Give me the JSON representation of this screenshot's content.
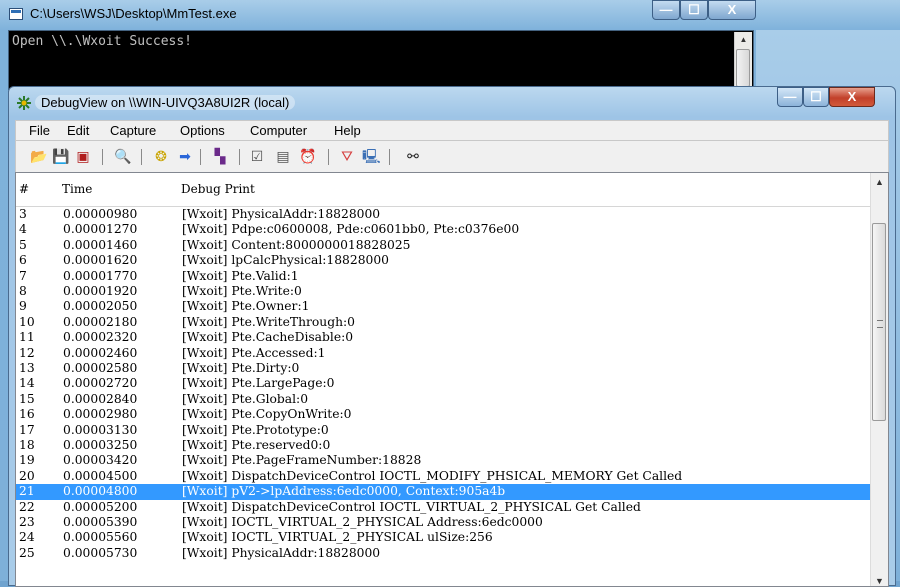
{
  "console": {
    "title": "C:\\Users\\WSJ\\Desktop\\MmTest.exe",
    "output": "Open \\\\.\\Wxoit Success!"
  },
  "window_controls": {
    "minimize": "—",
    "maximize": "☐",
    "close": "X"
  },
  "debugview": {
    "title": "DebugView on \\\\WIN-UIVQ3A8UI2R (local)",
    "menu": [
      "File",
      "Edit",
      "Capture",
      "Options",
      "Computer",
      "Help"
    ],
    "toolbar": [
      {
        "icon": "open-folder-icon",
        "glyph": "📂",
        "color": "#c8961e"
      },
      {
        "icon": "save-icon",
        "glyph": "💾",
        "color": "#1d2b8a"
      },
      {
        "icon": "clear-icon",
        "glyph": "▣",
        "color": "#b01c1c"
      },
      {
        "icon": "find-icon",
        "glyph": "🔍",
        "color": "#2a2a2a"
      },
      {
        "icon": "capture-icon",
        "glyph": "❂",
        "color": "#c9a400"
      },
      {
        "icon": "autoscroll-icon",
        "glyph": "➡",
        "color": "#2a66d9"
      },
      {
        "icon": "filter-icon",
        "glyph": "▚",
        "color": "#6b2a8a"
      },
      {
        "icon": "options-icon",
        "glyph": "☑",
        "color": "#555555"
      },
      {
        "icon": "history-icon",
        "glyph": "▤",
        "color": "#555555"
      },
      {
        "icon": "clock-icon",
        "glyph": "⏰",
        "color": "#c9a400"
      },
      {
        "icon": "highlight-icon",
        "glyph": "⛛",
        "color": "#d64040"
      },
      {
        "icon": "computer-icon",
        "glyph": "🖳",
        "color": "#3a6fb5"
      },
      {
        "icon": "binoculars-icon",
        "glyph": "⚯",
        "color": "#222222"
      }
    ],
    "columns": {
      "num": "#",
      "time": "Time",
      "message": "Debug Print"
    },
    "selected_row": "21",
    "rows": [
      {
        "num": "3",
        "time": "0.00000980",
        "msg": "[Wxoit] PhysicalAddr:18828000"
      },
      {
        "num": "4",
        "time": "0.00001270",
        "msg": "[Wxoit] Pdpe:c0600008, Pde:c0601bb0, Pte:c0376e00"
      },
      {
        "num": "5",
        "time": "0.00001460",
        "msg": "[Wxoit] Content:8000000018828025"
      },
      {
        "num": "6",
        "time": "0.00001620",
        "msg": "[Wxoit] lpCalcPhysical:18828000"
      },
      {
        "num": "7",
        "time": "0.00001770",
        "msg": "[Wxoit] Pte.Valid:1"
      },
      {
        "num": "8",
        "time": "0.00001920",
        "msg": "[Wxoit] Pte.Write:0"
      },
      {
        "num": "9",
        "time": "0.00002050",
        "msg": "[Wxoit] Pte.Owner:1"
      },
      {
        "num": "10",
        "time": "0.00002180",
        "msg": "[Wxoit] Pte.WriteThrough:0"
      },
      {
        "num": "11",
        "time": "0.00002320",
        "msg": "[Wxoit] Pte.CacheDisable:0"
      },
      {
        "num": "12",
        "time": "0.00002460",
        "msg": "[Wxoit] Pte.Accessed:1"
      },
      {
        "num": "13",
        "time": "0.00002580",
        "msg": "[Wxoit] Pte.Dirty:0"
      },
      {
        "num": "14",
        "time": "0.00002720",
        "msg": "[Wxoit] Pte.LargePage:0"
      },
      {
        "num": "15",
        "time": "0.00002840",
        "msg": "[Wxoit] Pte.Global:0"
      },
      {
        "num": "16",
        "time": "0.00002980",
        "msg": "[Wxoit] Pte.CopyOnWrite:0"
      },
      {
        "num": "17",
        "time": "0.00003130",
        "msg": "[Wxoit] Pte.Prototype:0"
      },
      {
        "num": "18",
        "time": "0.00003250",
        "msg": "[Wxoit] Pte.reserved0:0"
      },
      {
        "num": "19",
        "time": "0.00003420",
        "msg": "[Wxoit] Pte.PageFrameNumber:18828"
      },
      {
        "num": "20",
        "time": "0.00004500",
        "msg": "[Wxoit] DispatchDeviceControl IOCTL_MODIFY_PHSICAL_MEMORY Get Called"
      },
      {
        "num": "21",
        "time": "0.00004800",
        "msg": "[Wxoit] pV2->lpAddress:6edc0000, Context:905a4b"
      },
      {
        "num": "22",
        "time": "0.00005200",
        "msg": "[Wxoit] DispatchDeviceControl IOCTL_VIRTUAL_2_PHYSICAL Get Called"
      },
      {
        "num": "23",
        "time": "0.00005390",
        "msg": "[Wxoit] IOCTL_VIRTUAL_2_PHYSICAL Address:6edc0000"
      },
      {
        "num": "24",
        "time": "0.00005560",
        "msg": "[Wxoit] IOCTL_VIRTUAL_2_PHYSICAL ulSize:256"
      },
      {
        "num": "25",
        "time": "0.00005730",
        "msg": "[Wxoit] PhysicalAddr:18828000"
      }
    ]
  }
}
